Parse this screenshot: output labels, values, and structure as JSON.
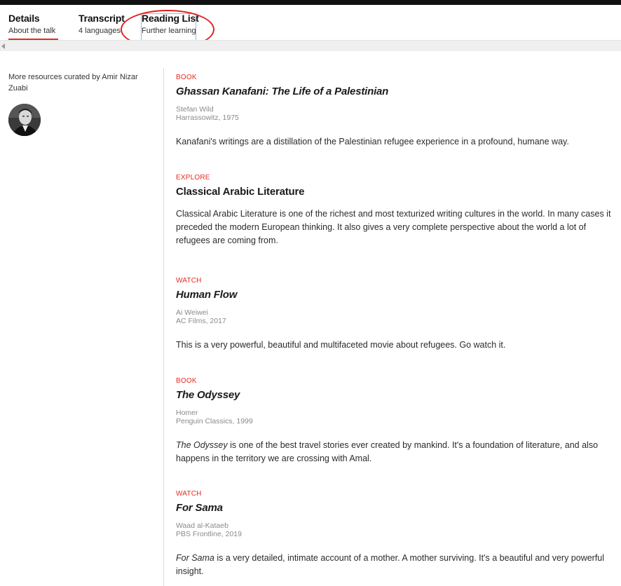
{
  "tabs": [
    {
      "title": "Details",
      "subtitle": "About the talk"
    },
    {
      "title": "Transcript",
      "subtitle": "4 languages"
    },
    {
      "title": "Reading List",
      "subtitle": "Further learning"
    }
  ],
  "active_tab": "Details",
  "accent_color": "#e62b1e",
  "annotation_color": "#e0201c",
  "sidebar": {
    "curated_text": "More resources curated by Amir Nizar Zuabi",
    "avatar_icon": "person-photo"
  },
  "items": [
    {
      "kind": "BOOK",
      "title": "Ghassan Kanafani: The Life of a Palestinian",
      "author": "Stefan Wild",
      "publisher": "Harrassowitz, 1975",
      "desc_em": "",
      "desc": "Kanafani's writings are a distillation of the Palestinian refugee experience in a profound, humane way."
    },
    {
      "kind": "EXPLORE",
      "title": "Classical Arabic Literature",
      "desc": "Classical Arabic Literature is one of the richest and most texturized writing cultures in the world. In many cases it preceded the modern European thinking. It also gives a very complete perspective about the world a lot of refugees are coming from."
    },
    {
      "kind": "WATCH",
      "title": "Human Flow",
      "author": "Ai Weiwei",
      "publisher": "AC Films, 2017",
      "desc": "This is a very powerful, beautiful and multifaceted movie about refugees. Go watch it."
    },
    {
      "kind": "BOOK",
      "title": "The Odyssey",
      "author": "Homer",
      "publisher": "Penguin Classics, 1999",
      "desc_em": "The Odyssey",
      "desc": " is one of the best travel stories ever created by mankind. It's a foundation of literature, and also happens in the territory we are crossing with Amal."
    },
    {
      "kind": "WATCH",
      "title": "For Sama",
      "author": "Waad al-Kataeb",
      "publisher": "PBS Frontline, 2019",
      "desc_em": "For Sama",
      "desc": " is a very detailed, intimate account of a mother. A mother surviving. It's a beautiful and very powerful insight."
    }
  ]
}
